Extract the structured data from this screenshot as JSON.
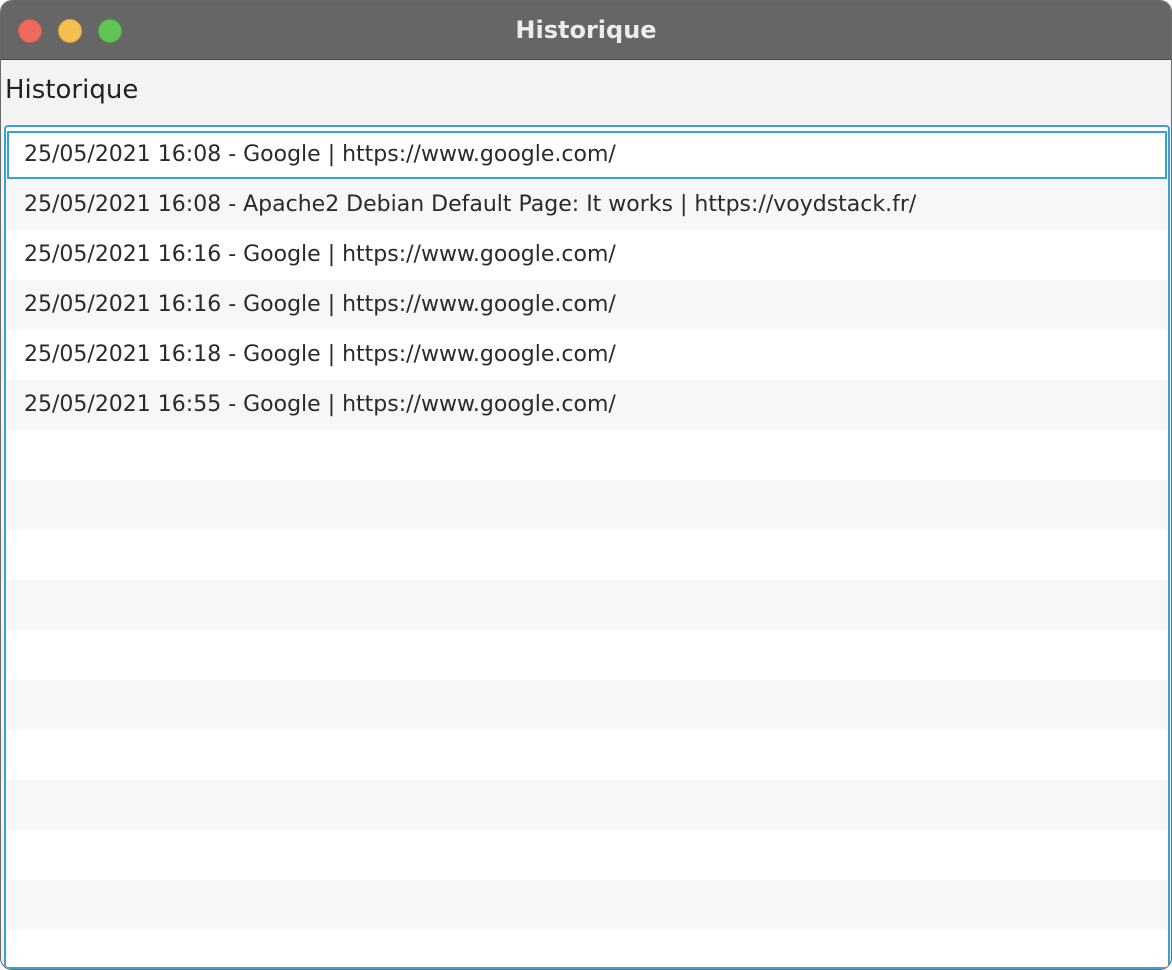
{
  "window": {
    "title": "Historique"
  },
  "header": {
    "label": "Historique"
  },
  "history": {
    "items": [
      {
        "text": "25/05/2021 16:08 - Google | https://www.google.com/"
      },
      {
        "text": "25/05/2021 16:08 - Apache2 Debian Default Page: It works | https://voydstack.fr/"
      },
      {
        "text": "25/05/2021 16:16 - Google | https://www.google.com/"
      },
      {
        "text": "25/05/2021 16:16 - Google | https://www.google.com/"
      },
      {
        "text": "25/05/2021 16:18 - Google | https://www.google.com/"
      },
      {
        "text": "25/05/2021 16:55 - Google | https://www.google.com/"
      }
    ]
  },
  "colors": {
    "titlebar": "#666666",
    "close": "#ed6a5e",
    "minimize": "#f5bf4f",
    "zoom": "#61c554",
    "focus_ring": "#35a3d3",
    "row_alt": "#f7f7f7"
  }
}
